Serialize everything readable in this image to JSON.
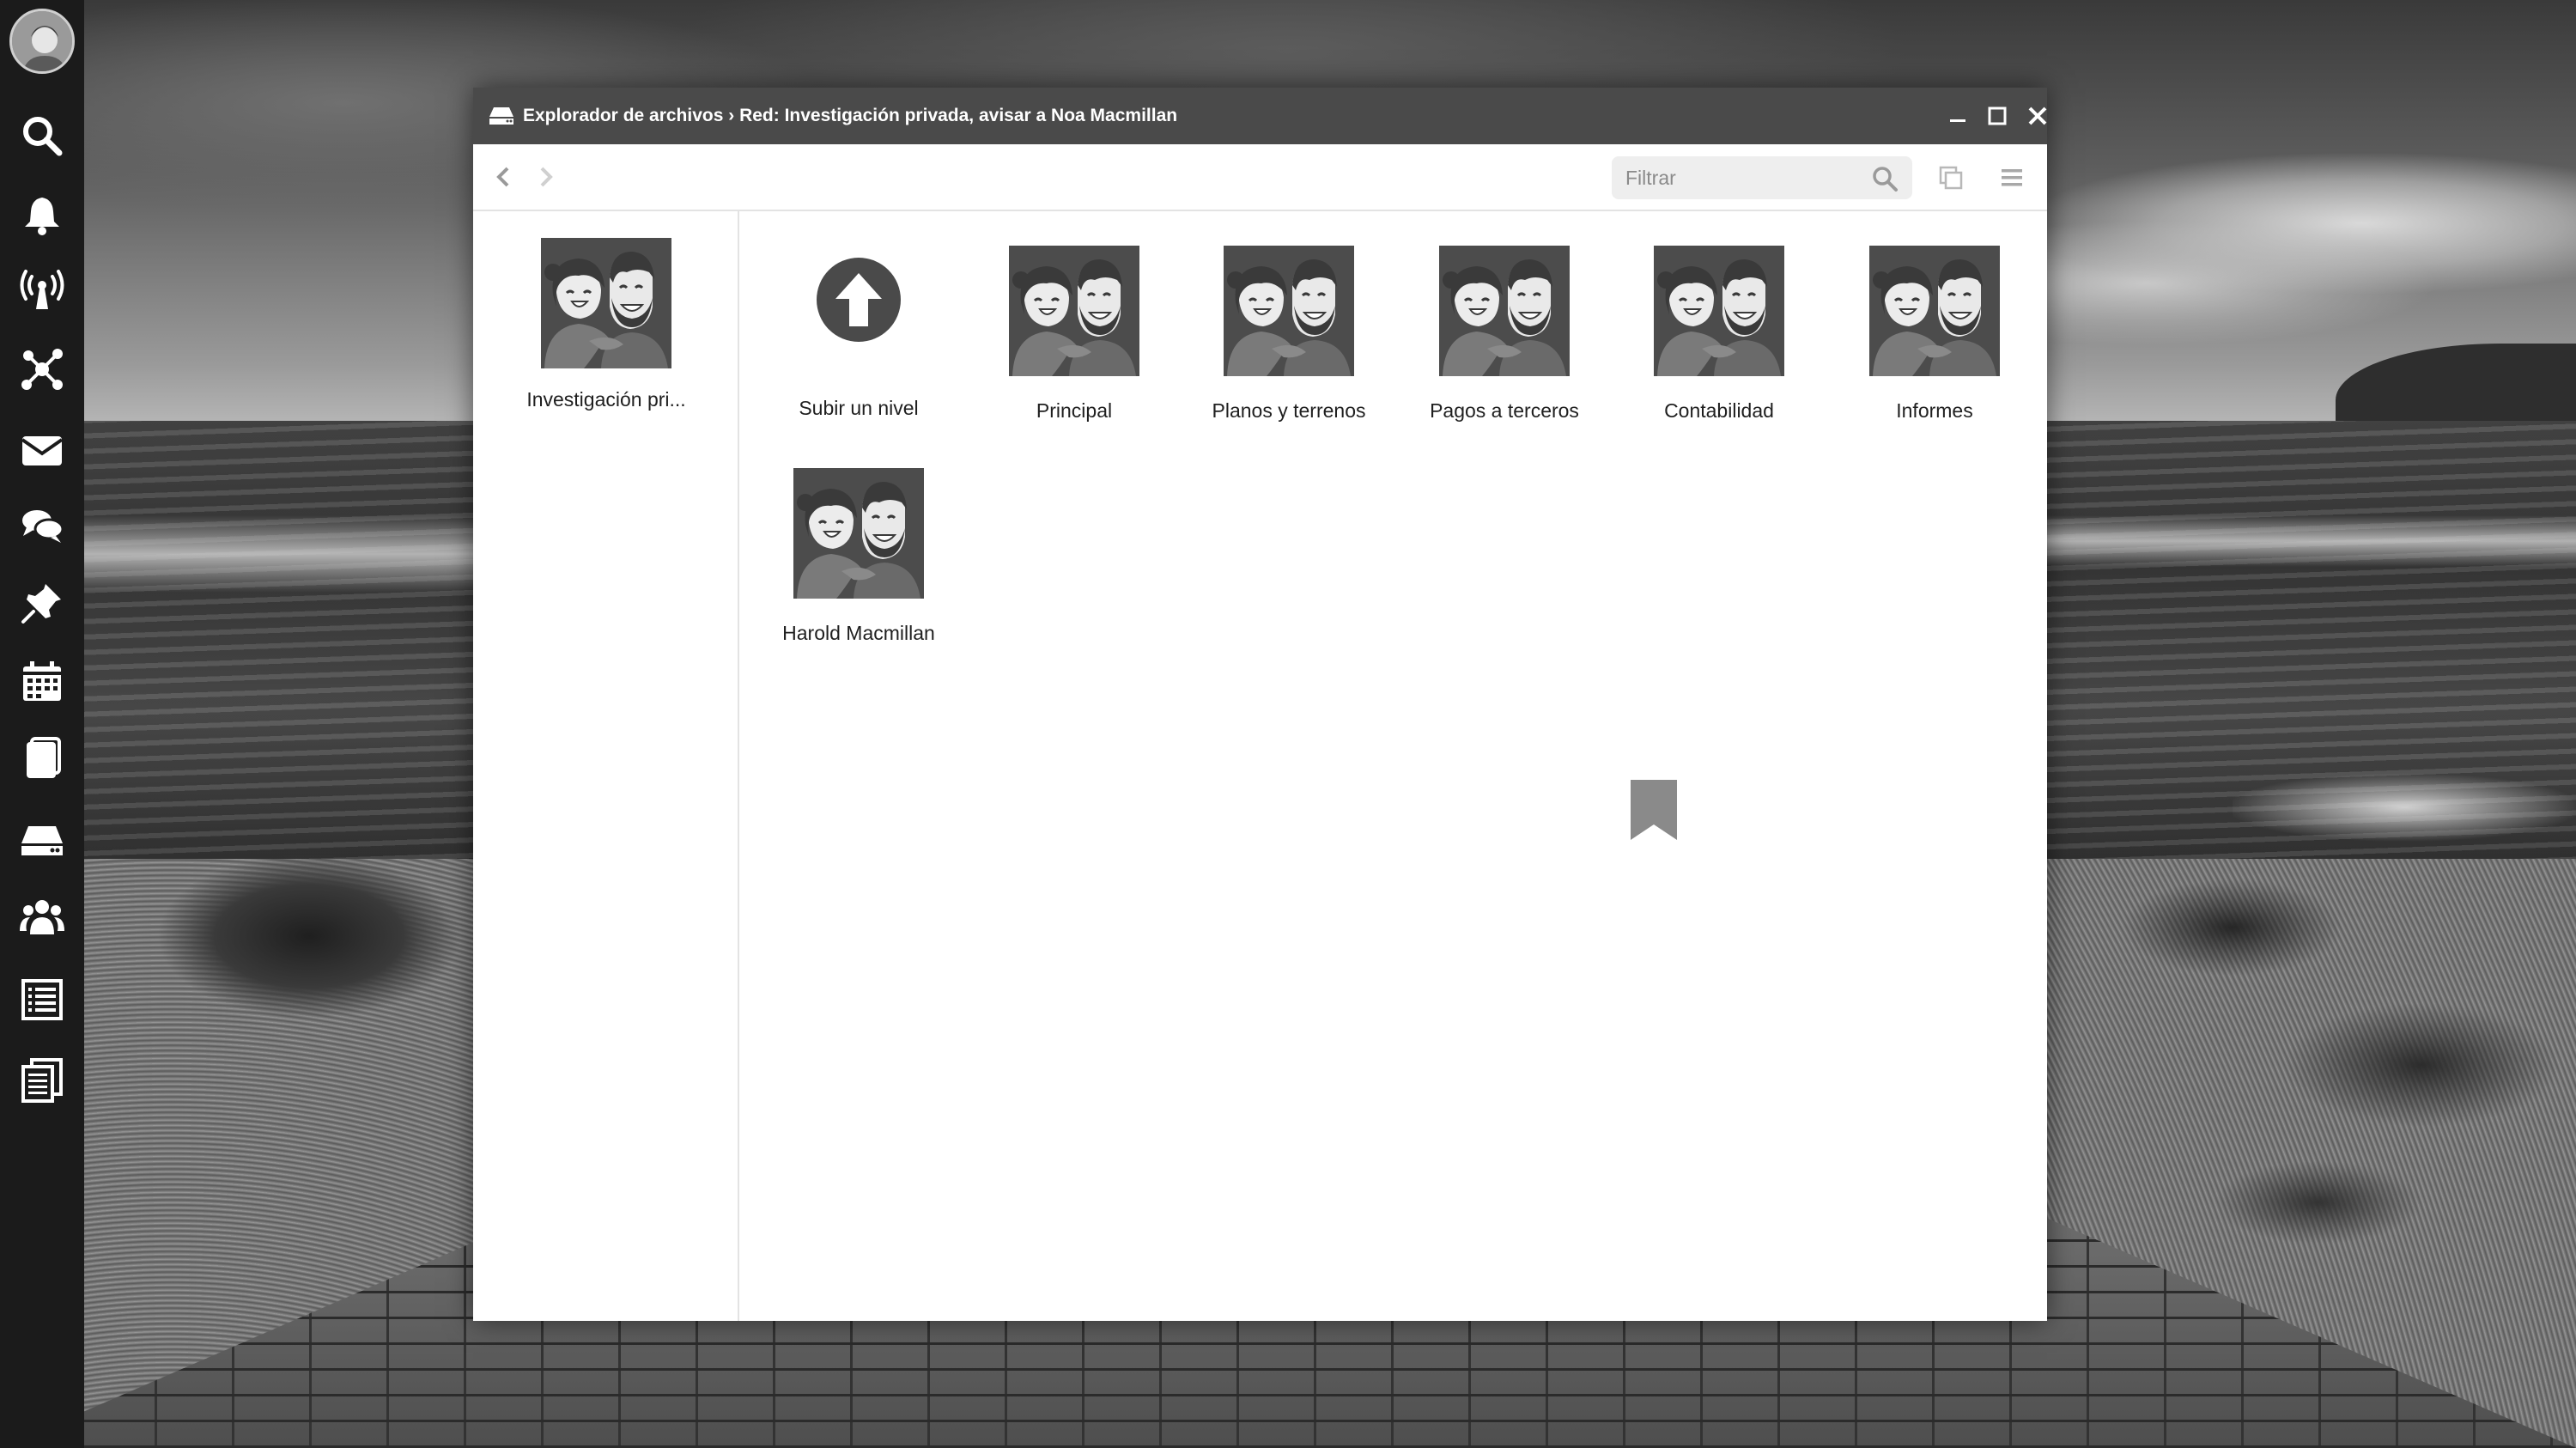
{
  "window": {
    "title": "Explorador de archivos › Red: Investigación privada, avisar a Noa Macmillan"
  },
  "toolbar": {
    "filter_placeholder": "Filtrar"
  },
  "sidebar": {
    "items": [
      {
        "label": "Investigación pri..."
      }
    ]
  },
  "content": {
    "up_label": "Subir un nivel",
    "folders": [
      {
        "label": "Principal"
      },
      {
        "label": "Planos y terrenos"
      },
      {
        "label": "Pagos a terceros"
      },
      {
        "label": "Contabilidad"
      },
      {
        "label": "Informes"
      },
      {
        "label": "Harold Macmillan"
      }
    ]
  },
  "dock": {
    "icons": [
      "search-icon",
      "bell-icon",
      "broadcast-icon",
      "network-icon",
      "mail-icon",
      "chat-icon",
      "pin-icon",
      "calendar-icon",
      "notebook-icon",
      "drive-icon",
      "people-icon",
      "list-icon",
      "documents-icon"
    ]
  }
}
